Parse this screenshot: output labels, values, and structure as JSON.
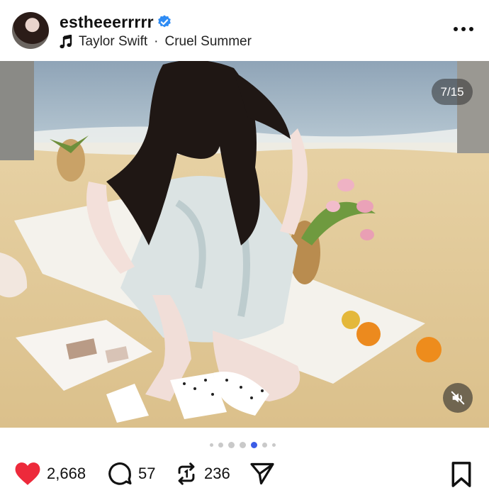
{
  "post": {
    "username": "estheeerrrrr",
    "verified": true,
    "artist": "Taylor Swift",
    "separator": "·",
    "song": "Cruel Summer"
  },
  "carousel": {
    "counter": "7/15",
    "total_dots_visible": 7,
    "active_dot": 4
  },
  "actions": {
    "likes": "2,668",
    "comments": "57",
    "reposts": "236"
  },
  "colors": {
    "like_red": "#ed2a3b",
    "dot_active": "#3b5ce6",
    "verified_blue": "#2f8cf4"
  },
  "icons": [
    "verified-badge-icon",
    "music-note-icon",
    "more-icon",
    "mute-icon",
    "heart-icon",
    "comment-icon",
    "repost-icon",
    "share-icon",
    "bookmark-icon"
  ]
}
